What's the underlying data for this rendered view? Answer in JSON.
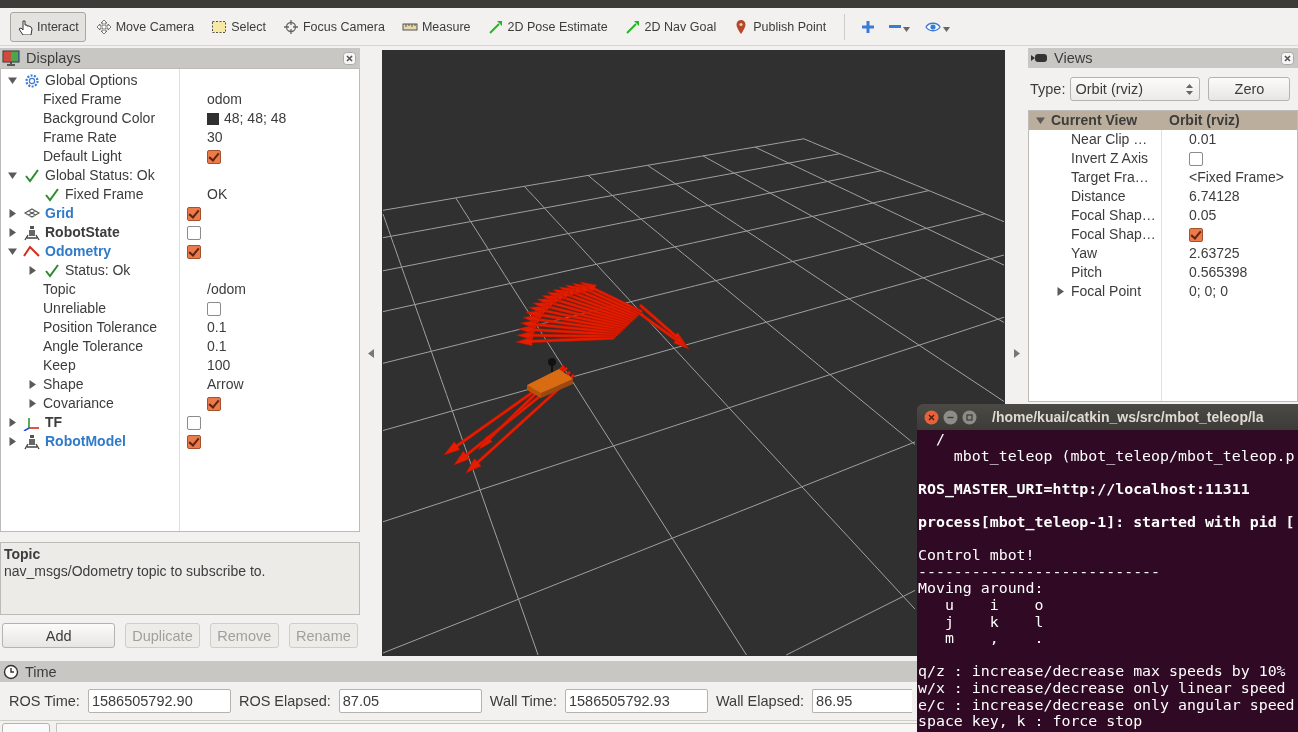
{
  "toolbar": {
    "tools": [
      {
        "kind": "interact",
        "label": "Interact",
        "selected": true
      },
      {
        "kind": "move",
        "label": "Move Camera",
        "selected": false
      },
      {
        "kind": "select",
        "label": "Select",
        "selected": false
      },
      {
        "kind": "focus",
        "label": "Focus Camera",
        "selected": false
      },
      {
        "kind": "measure",
        "label": "Measure",
        "selected": false
      },
      {
        "kind": "pose",
        "label": "2D Pose Estimate",
        "selected": false
      },
      {
        "kind": "goal",
        "label": "2D Nav Goal",
        "selected": false
      },
      {
        "kind": "point",
        "label": "Publish Point",
        "selected": false
      }
    ],
    "actions": [
      {
        "kind": "add",
        "dropdown": false
      },
      {
        "kind": "remove",
        "dropdown": true
      },
      {
        "kind": "view",
        "dropdown": true
      }
    ]
  },
  "displays": {
    "title": "Displays",
    "tree": [
      {
        "kind": "options",
        "label": "Global Options",
        "expanded": true,
        "children": [
          {
            "kind": "property",
            "label": "Fixed Frame",
            "value": "odom"
          },
          {
            "kind": "property",
            "label": "Background Color",
            "value": "48; 48; 48",
            "color": "#303030"
          },
          {
            "kind": "property",
            "label": "Frame Rate",
            "value": "30"
          },
          {
            "kind": "property",
            "label": "Default Light",
            "checked": true
          }
        ]
      },
      {
        "kind": "status",
        "label": "Global Status: Ok",
        "expanded": true,
        "children": [
          {
            "kind": "status",
            "label": "Fixed Frame",
            "value": "OK"
          }
        ]
      },
      {
        "kind": "grid",
        "label": "Grid",
        "expanded": false,
        "checked": true
      },
      {
        "kind": "robot",
        "label": "RobotState",
        "expanded": false,
        "checked": false
      },
      {
        "kind": "odometry",
        "label": "Odometry",
        "expanded": true,
        "checked": true,
        "children": [
          {
            "kind": "status",
            "label": "Status: Ok",
            "expanded": false
          },
          {
            "kind": "property",
            "label": "Topic",
            "value": "/odom"
          },
          {
            "kind": "property",
            "label": "Unreliable",
            "checked": false
          },
          {
            "kind": "property",
            "label": "Position Tolerance",
            "value": "0.1"
          },
          {
            "kind": "property",
            "label": "Angle Tolerance",
            "value": "0.1"
          },
          {
            "kind": "property",
            "label": "Keep",
            "value": "100"
          },
          {
            "kind": "property",
            "label": "Shape",
            "value": "Arrow",
            "expanded": false
          },
          {
            "kind": "property",
            "label": "Covariance",
            "checked": true,
            "expanded": false
          }
        ]
      },
      {
        "kind": "tf",
        "label": "TF",
        "expanded": false,
        "checked": false
      },
      {
        "kind": "robot",
        "label": "RobotModel",
        "expanded": false,
        "checked": true
      }
    ],
    "description": {
      "title": "Topic",
      "text": "nav_msgs/Odometry topic to subscribe to."
    },
    "buttons": [
      {
        "label": "Add",
        "disabled": false
      },
      {
        "label": "Duplicate",
        "disabled": true
      },
      {
        "label": "Remove",
        "disabled": true
      },
      {
        "label": "Rename",
        "disabled": true
      }
    ]
  },
  "views": {
    "title": "Views",
    "type_label": "Type:",
    "type_value": "Orbit (rviz)",
    "zero_button": "Zero",
    "tree": [
      {
        "kind": "header",
        "label": "Current View",
        "value": "Orbit (rviz)",
        "expanded": true,
        "children": [
          {
            "kind": "property",
            "label": "Near Clip …",
            "value": "0.01"
          },
          {
            "kind": "property",
            "label": "Invert Z Axis",
            "checked": false
          },
          {
            "kind": "property",
            "label": "Target Fra…",
            "value": "<Fixed Frame>"
          },
          {
            "kind": "property",
            "label": "Distance",
            "value": "6.74128"
          },
          {
            "kind": "property",
            "label": "Focal Shap…",
            "value": "0.05"
          },
          {
            "kind": "property",
            "label": "Focal Shap…",
            "checked": true
          },
          {
            "kind": "property",
            "label": "Yaw",
            "value": "2.63725"
          },
          {
            "kind": "property",
            "label": "Pitch",
            "value": "0.565398"
          },
          {
            "kind": "property",
            "label": "Focal Point",
            "value": "0; 0; 0",
            "expanded": false
          }
        ]
      }
    ]
  },
  "time": {
    "title": "Time",
    "fields": [
      {
        "label": "ROS Time:",
        "value": "1586505792.90"
      },
      {
        "label": "ROS Elapsed:",
        "value": "87.05"
      },
      {
        "label": "Wall Time:",
        "value": "1586505792.93"
      },
      {
        "label": "Wall Elapsed:",
        "value": "86.95"
      }
    ]
  },
  "terminal": {
    "title": "/home/kuai/catkin_ws/src/mbot_teleop/la",
    "blocks": [
      [
        {
          "text": "  /",
          "bold": false
        },
        {
          "text": "    mbot_teleop (mbot_teleop/mbot_teleop.p",
          "bold": false
        }
      ],
      [
        {
          "text": "ROS_MASTER_URI=http://localhost:11311",
          "bold": true
        }
      ],
      [
        {
          "text": "process[mbot_teleop-1]: started with pid [",
          "bold": true
        }
      ],
      [
        {
          "text": "Control mbot!",
          "bold": false
        },
        {
          "text": "---------------------------",
          "bold": false
        },
        {
          "text": "Moving around:",
          "bold": false
        },
        {
          "text": "   u    i    o",
          "bold": false
        },
        {
          "text": "   j    k    l",
          "bold": false
        },
        {
          "text": "   m    ,    .",
          "bold": false
        }
      ],
      [
        {
          "text": "q/z : increase/decrease max speeds by 10%",
          "bold": false
        },
        {
          "text": "w/x : increase/decrease only linear speed",
          "bold": false
        },
        {
          "text": "e/c : increase/decrease only angular speed",
          "bold": false
        },
        {
          "text": "space key, k : force stop",
          "bold": false
        }
      ]
    ]
  }
}
